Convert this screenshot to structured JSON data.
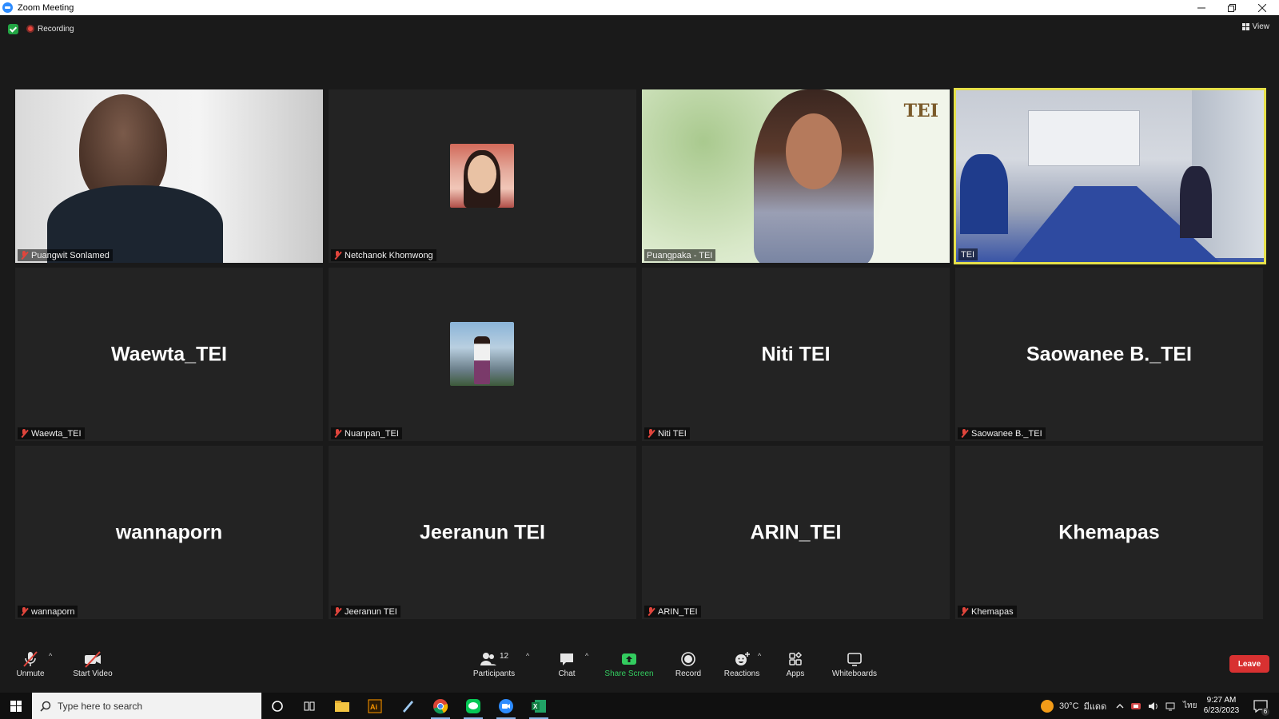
{
  "window": {
    "title": "Zoom Meeting"
  },
  "topbar": {
    "recording_label": "Recording",
    "view_label": "View"
  },
  "tiles": [
    {
      "name": "Puangwit Sonlamed",
      "big": ""
    },
    {
      "name": "Netchanok Khomwong",
      "big": ""
    },
    {
      "name": "Puangpaka - TEI",
      "big": ""
    },
    {
      "name": "TEI",
      "big": ""
    },
    {
      "name": "Waewta_TEI",
      "big": "Waewta_TEI"
    },
    {
      "name": "Nuanpan_TEI",
      "big": ""
    },
    {
      "name": "Niti TEI",
      "big": "Niti TEI"
    },
    {
      "name": "Saowanee B._TEI",
      "big": "Saowanee B._TEI"
    },
    {
      "name": "wannaporn",
      "big": "wannaporn"
    },
    {
      "name": "Jeeranun TEI",
      "big": "Jeeranun TEI"
    },
    {
      "name": "ARIN_TEI",
      "big": "ARIN_TEI"
    },
    {
      "name": "Khemapas",
      "big": "Khemapas"
    }
  ],
  "video_logo_text": "TEI",
  "toolbar": {
    "unmute": "Unmute",
    "start_video": "Start Video",
    "participants": "Participants",
    "participants_count": "12",
    "chat": "Chat",
    "share_screen": "Share Screen",
    "record": "Record",
    "reactions": "Reactions",
    "apps": "Apps",
    "whiteboards": "Whiteboards",
    "leave": "Leave"
  },
  "taskbar": {
    "search_placeholder": "Type here to search",
    "weather": "30°C",
    "weather_text": "มีแดด",
    "language": "ไทย",
    "time": "9:27 AM",
    "date": "6/23/2023",
    "notifications": "6"
  },
  "colors": {
    "active_speaker": "#e5e04a",
    "leave": "#d83131",
    "share": "#33cc5f",
    "muted": "#e0453c"
  }
}
